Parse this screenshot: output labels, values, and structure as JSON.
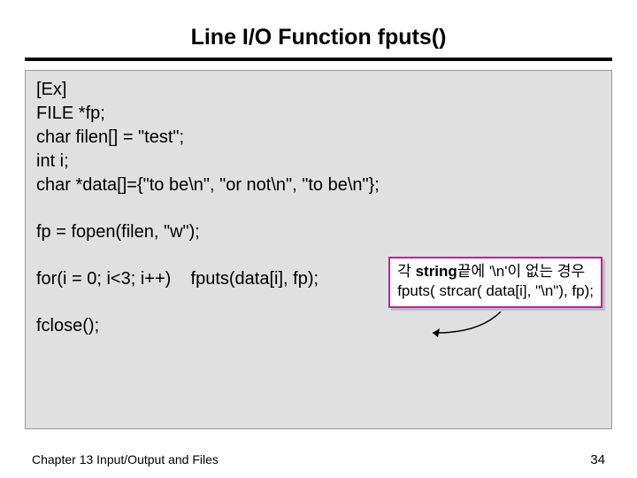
{
  "title": "Line I/O Function fputs()",
  "code": {
    "l1": "[Ex]",
    "l2": "FILE *fp;",
    "l3": "char filen[] = \"test\";",
    "l4": "int i;",
    "l5": "char *data[]={\"to be\\n\", \"or not\\n\", \"to be\\n\"};",
    "l6": "fp = fopen(filen, \"w\");",
    "l7": "for(i = 0; i<3; i++)    fputs(data[i], fp);",
    "l8": "fclose();"
  },
  "callout": {
    "line1a": "각 ",
    "line1b": "string",
    "line1c": "끝에 '\\n'이 없는 경우",
    "line2": "fputs( strcar( data[i], \"\\n\"), fp);"
  },
  "footer": {
    "chapter": "Chapter 13  Input/Output and Files",
    "page": "34"
  }
}
